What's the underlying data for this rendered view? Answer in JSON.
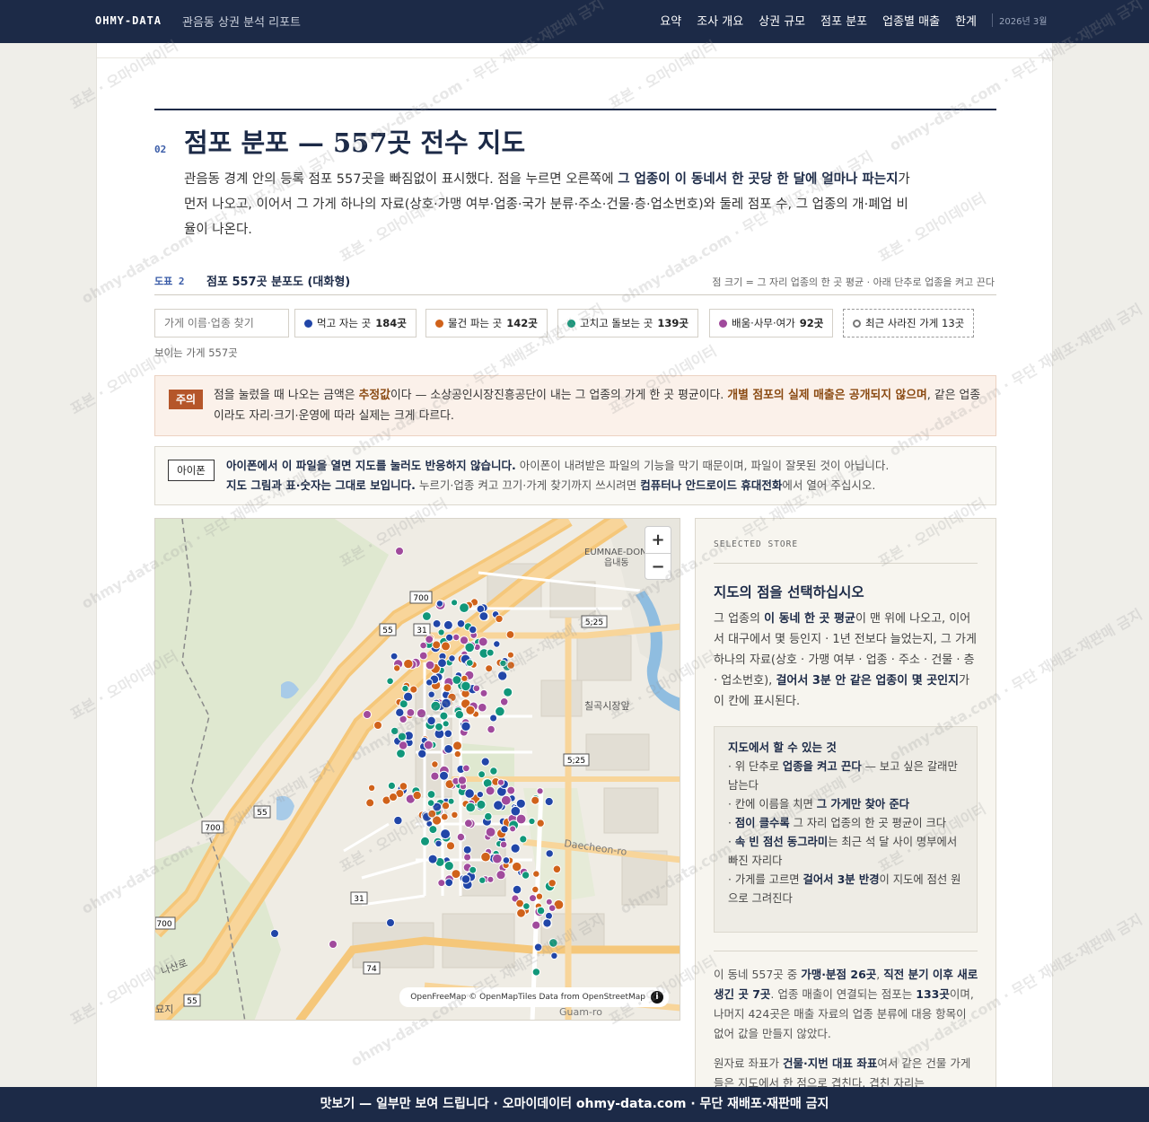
{
  "nav": {
    "brand": "OHMY-DATA",
    "subtitle": "관음동 상권 분석 리포트",
    "links": [
      "요약",
      "조사 개요",
      "상권 규모",
      "점포 분포",
      "업종별 매출",
      "한계"
    ],
    "date": "2026년 3월"
  },
  "section": {
    "number": "02",
    "title": "점포 분포 — 557곳 전수 지도",
    "intro_1": "관음동 경계 안의 등록 점포 557곳을 빠짐없이 표시했다. 점을 누르면 오른쪽에 ",
    "intro_bold": "그 업종이 이 동네서 한 곳당 한 달에 얼마나 파는지",
    "intro_2": "가 먼저 나오고, 이어서 그 가게 하나의 자료(상호·가맹 여부·업종·국가 분류·주소·건물·층·업소번호)와 둘레 점포 수, 그 업종의 개·폐업 비율이 나온다."
  },
  "figure": {
    "label": "도표 2",
    "title": "점포 557곳 분포도 (대화형)",
    "note": "점 크기 = 그 자리 업종의 한 곳 평균 · 아래 단추로 업종을 켜고 끈다"
  },
  "filters": {
    "search_placeholder": "가게 이름·업종 찾기",
    "chips": [
      {
        "label": "먹고 자는 곳",
        "count": "184곳",
        "color": "#2146a8"
      },
      {
        "label": "물건 파는 곳",
        "count": "142곳",
        "color": "#d0621a"
      },
      {
        "label": "고치고 돌보는 곳",
        "count": "139곳",
        "color": "#11977a"
      },
      {
        "label": "배움·사무·여가",
        "count": "92곳",
        "color": "#a04a9c"
      }
    ],
    "closed_chip": "최근 사라진 가게 13곳",
    "visible_count": "보이는 가게 557곳"
  },
  "notice": {
    "badge": "주의",
    "text_1": "점을 눌렀을 때 나오는 금액은 ",
    "bold_1": "추정값",
    "text_2": "이다 — 소상공인시장진흥공단이 내는 그 업종의 가게 한 곳 평균이다. ",
    "bold_2": "개별 점포의 실제 매출은 공개되지 않으며",
    "text_3": ", 같은 업종이라도 자리·크기·운영에 따라 실제는 크게 다르다."
  },
  "ios": {
    "badge": "아이폰",
    "bold_1": "아이폰에서 이 파일을 열면 지도를 눌러도 반응하지 않습니다.",
    "text_1": " 아이폰이 내려받은 파일의 기능을 막기 때문이며, 파일이 잘못된 것이 아닙니다.",
    "bold_2": "지도 그림과 표·숫자는 그대로 보입니다.",
    "text_2": " 누르기·업종 켜고 끄기·가게 찾기까지 쓰시려면 ",
    "bold_3": "컴퓨터나 안드로이드 휴대전화",
    "text_3": "에서 열어 주십시오."
  },
  "map": {
    "zoom_in": "+",
    "zoom_out": "−",
    "attribution": "OpenFreeMap © OpenMapTiles Data from OpenStreetMap",
    "labels": {
      "district": "EUMNAE-DONG",
      "district_ko": "읍내동",
      "market": "칠곡시장앞",
      "road": "Daecheon-ro",
      "road2": "Guam-ro",
      "nasan": "나산로",
      "cemetery": "묘지",
      "route700": "700",
      "route55": "55",
      "route31": "31",
      "route525": "5;25",
      "route74": "74"
    }
  },
  "panel": {
    "kicker": "SELECTED STORE",
    "title": "지도의 점을 선택하십시오",
    "d1": "그 업종의 ",
    "d1b": "이 동네 한 곳 평균",
    "d2": "이 맨 위에 나오고, 이어서 대구에서 몇 등인지 · 1년 전보다 늘었는지, 그 가게 하나의 자료(상호 · 가맹 여부 · 업종 · 주소 · 건물 · 층 · 업소번호), ",
    "d2b": "걸어서 3분 안 같은 업종이 몇 곳인지",
    "d3": "가 이 칸에 표시된다.",
    "howto_title": "지도에서 할 수 있는 것",
    "h1a": "· 위 단추로 ",
    "h1b": "업종을 켜고 끈다",
    "h1c": " — 보고 싶은 갈래만 남는다",
    "h2a": "· 칸에 이름을 치면 ",
    "h2b": "그 가게만 찾아 준다",
    "h3a": "· ",
    "h3b": "점이 클수록",
    "h3c": " 그 자리 업종의 한 곳 평균이 크다",
    "h4a": "· ",
    "h4b": "속 빈 점선 동그라미",
    "h4c": "는 최근 석 달 사이 명부에서 빠진 자리다",
    "h5a": "· 가게를 고르면 ",
    "h5b": "걸어서 3분 반경",
    "h5c": "이 지도에 점선 원으로 그려진다",
    "s1": "이 동네 557곳 중 ",
    "s1b": "가맹·분점 26곳",
    "s2": ", ",
    "s2b": "직전 분기 이후 새로 생긴 곳 7곳",
    "s3": ". 업종 매출이 연결되는 점포는 ",
    "s3b": "133곳",
    "s4": "이며, 나머지 424곳은 매출 자료의 업종 분류에 대응 항목이 없어 값을 만들지 않았다.",
    "src1": "원자료 좌표가 ",
    "src1b": "건물·지번 대표 좌표",
    "src2": "여서 같은 건물 가게들은 지도에서 한 점으로 겹친다. 겹친 자리는"
  },
  "watermark": "표본 · 오마이데이터",
  "watermark2": "ohmy-data.com · 무단 재배포·재판매 금지",
  "footer": "맛보기 — 일부만 보여 드립니다 · 오마이데이터 ohmy-data.com · 무단 재배포·재판매 금지"
}
